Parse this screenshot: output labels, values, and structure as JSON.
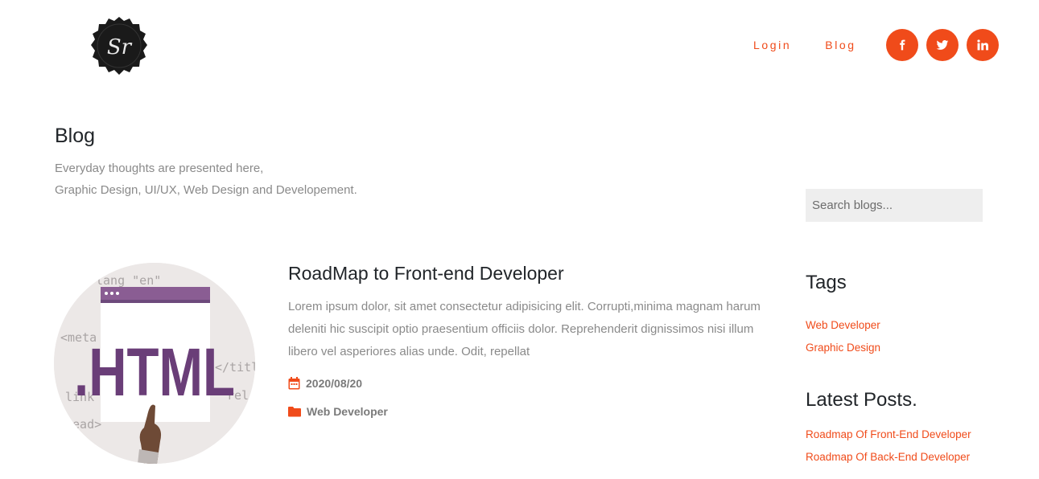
{
  "header": {
    "logo_text": "Sr",
    "nav": [
      {
        "label": "Login"
      },
      {
        "label": "Blog"
      }
    ],
    "social": [
      {
        "icon": "facebook-icon",
        "glyph": "f"
      },
      {
        "icon": "twitter-icon",
        "glyph": "t"
      },
      {
        "icon": "linkedin-icon",
        "glyph": "in"
      }
    ]
  },
  "colors": {
    "accent": "#f04b1a",
    "muted_text": "#8a8a8a",
    "heading": "#212529"
  },
  "intro": {
    "title": "Blog",
    "line1": "Everyday thoughts are presented here,",
    "line2": "Graphic Design, UI/UX, Web Design and Developement."
  },
  "post": {
    "image_text": ".HTML",
    "title": "RoadMap to Front-end Developer",
    "excerpt": "Lorem ipsum dolor, sit amet consectetur adipisicing elit. Corrupti,minima magnam harum deleniti hic suscipit optio praesentium officiis dolor. Reprehenderit dignissimos nisi illum libero vel asperiores alias unde. Odit, repellat",
    "date": "2020/08/20",
    "category": "Web Developer"
  },
  "sidebar": {
    "search_placeholder": "Search blogs...",
    "tags_title": "Tags",
    "tags": [
      "Web Developer",
      "Graphic Design"
    ],
    "latest_title": "Latest Posts.",
    "latest": [
      "Roadmap Of Front-End Developer",
      "Roadmap Of Back-End Developer"
    ]
  }
}
